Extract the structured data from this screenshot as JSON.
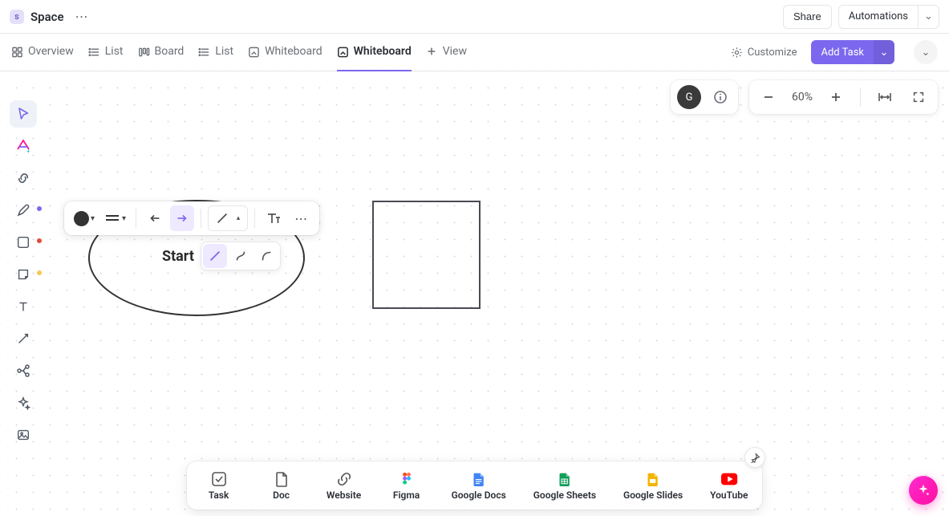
{
  "header": {
    "space_badge_letter": "s",
    "space_title": "Space",
    "share_label": "Share",
    "automations_label": "Automations"
  },
  "nav": {
    "tabs": [
      {
        "label": "Overview",
        "icon": "overview"
      },
      {
        "label": "List",
        "icon": "list"
      },
      {
        "label": "Board",
        "icon": "board"
      },
      {
        "label": "List",
        "icon": "list"
      },
      {
        "label": "Whiteboard",
        "icon": "whiteboard"
      },
      {
        "label": "Whiteboard",
        "icon": "whiteboard",
        "active": true
      }
    ],
    "add_view_label": "View",
    "customize_label": "Customize",
    "add_task_label": "Add Task"
  },
  "canvas_top": {
    "avatar_letter": "G",
    "zoom_text": "60%"
  },
  "context_toolbar": {
    "fill_color": "#333333"
  },
  "start_label": "Start",
  "tray": [
    {
      "label": "Task"
    },
    {
      "label": "Doc"
    },
    {
      "label": "Website"
    },
    {
      "label": "Figma"
    },
    {
      "label": "Google Docs"
    },
    {
      "label": "Google Sheets"
    },
    {
      "label": "Google Slides"
    },
    {
      "label": "YouTube"
    }
  ]
}
